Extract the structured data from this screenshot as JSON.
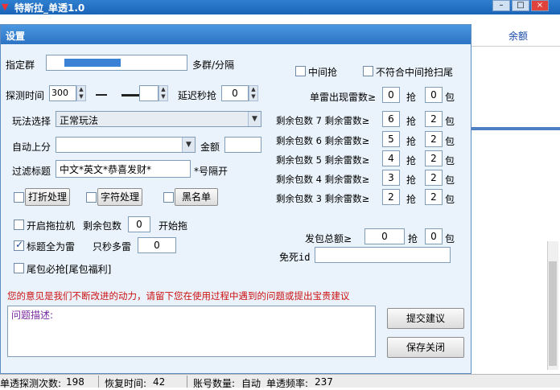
{
  "main_window": {
    "title": "特斯拉_单透1.0",
    "columns": [
      "",
      "余额"
    ],
    "status": {
      "detect_count_label": "单透探测次数:",
      "detect_count": "198",
      "recover_time_label": "恢复时间:",
      "recover_time": "42",
      "account_count_label": "账号数量:",
      "account_count": "自动",
      "frequency_label": "单透频率:",
      "frequency": "237"
    }
  },
  "dialog": {
    "title": "设置",
    "group_label": "指定群",
    "group_suffix": "多群/分隔",
    "detect_time_label": "探测时间",
    "detect_time_value": "300",
    "delay_label": "延迟秒抢",
    "delay_value": "0",
    "play_label": "玩法选择",
    "play_value": "正常玩法",
    "auto_score_label": "自动上分",
    "auto_score_value": "",
    "amount_label": "金额",
    "amount_value": "",
    "filter_label": "过滤标题",
    "filter_value": "中文*英文*恭喜发财*",
    "filter_hint": "*号隔开",
    "btn_discount": "打折处理",
    "btn_char": "字符处理",
    "btn_blacklist": "黑名单",
    "tractor_label": "开启拖拉机",
    "remaining_label": "剩余包数",
    "remaining_value": "0",
    "start_drag_label": "开始拖",
    "all_mine_label": "标题全为雷",
    "seconds_mine_label": "只秒多雷",
    "seconds_mine_value": "0",
    "tail_label": "尾包必抢[尾包福利]",
    "middle_grab_label": "中间抢",
    "non_middle_label": "不符合中间抢扫尾",
    "rules": [
      {
        "label": "单雷出现雷数≥",
        "mines": "0",
        "grab": "抢",
        "packs": "0",
        "unit": "包"
      },
      {
        "label": "剩余包数 7 剩余雷数≥",
        "mines": "6",
        "grab": "抢",
        "packs": "2",
        "unit": "包"
      },
      {
        "label": "剩余包数 6 剩余雷数≥",
        "mines": "5",
        "grab": "抢",
        "packs": "2",
        "unit": "包"
      },
      {
        "label": "剩余包数 5 剩余雷数≥",
        "mines": "4",
        "grab": "抢",
        "packs": "2",
        "unit": "包"
      },
      {
        "label": "剩余包数 4 剩余雷数≥",
        "mines": "3",
        "grab": "抢",
        "packs": "2",
        "unit": "包"
      },
      {
        "label": "剩余包数 3 剩余雷数≥",
        "mines": "2",
        "grab": "抢",
        "packs": "2",
        "unit": "包"
      }
    ],
    "send_total_label": "发包总额≥",
    "send_total_value": "0",
    "send_grab": "抢",
    "send_packs": "0",
    "send_unit": "包",
    "immune_label": "免死id",
    "immune_value": "",
    "feedback_notice": "您的意见是我们不断改进的动力，请留下您在使用过程中遇到的问题或提出宝贵建议",
    "feedback_placeholder": "问题描述:",
    "btn_submit": "提交建议",
    "btn_save_close": "保存关闭"
  },
  "colors": {
    "titlebar": "#2c74c4",
    "dialog_bg": "#eaf3fb",
    "notice_red": "#cc1111",
    "feedback_purple": "#7a2aa0"
  }
}
